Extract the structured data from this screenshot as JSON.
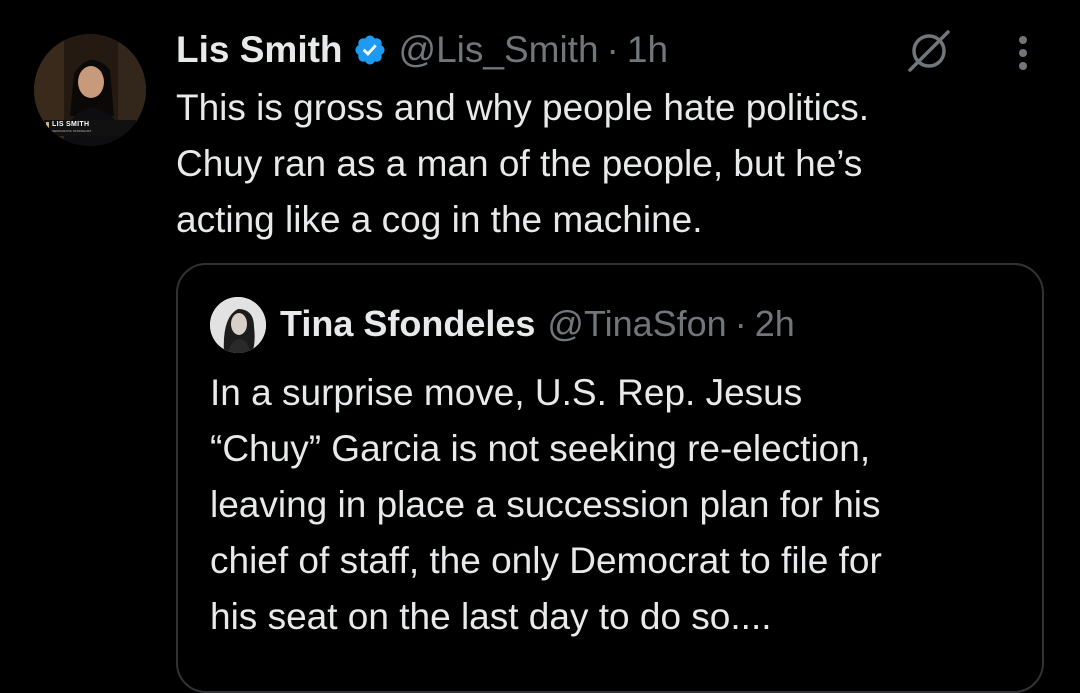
{
  "colors": {
    "background": "#000000",
    "primary_text": "#e7e9ea",
    "secondary_text": "#71767b",
    "verified_badge": "#1d9bf0",
    "quote_border": "#2f3336"
  },
  "tweet": {
    "author": {
      "name": "Lis Smith",
      "handle": "@Lis_Smith",
      "verified": true,
      "avatar_caption": "LIS SMITH",
      "avatar_subcaption": "DEMOCRATIC STRATEGIST"
    },
    "separator": "·",
    "time": "1h",
    "icons": {
      "verified": "verified-badge-icon",
      "grok": "grok-icon",
      "more": "more-options-icon"
    },
    "text_lines": [
      "This is gross and why people hate politics.",
      "Chuy ran as a man of the people, but he’s",
      "acting like a cog in the machine."
    ]
  },
  "quoted_tweet": {
    "author": {
      "name": "Tina Sfondeles",
      "handle": "@TinaSfon"
    },
    "separator": "·",
    "time": "2h",
    "text_lines": [
      "In a surprise move, U.S. Rep. Jesus",
      "“Chuy” Garcia is not seeking re-election,",
      "leaving in place a succession plan for his",
      "chief of staff, the only Democrat to file for",
      "his seat on the last day to do so...."
    ]
  }
}
